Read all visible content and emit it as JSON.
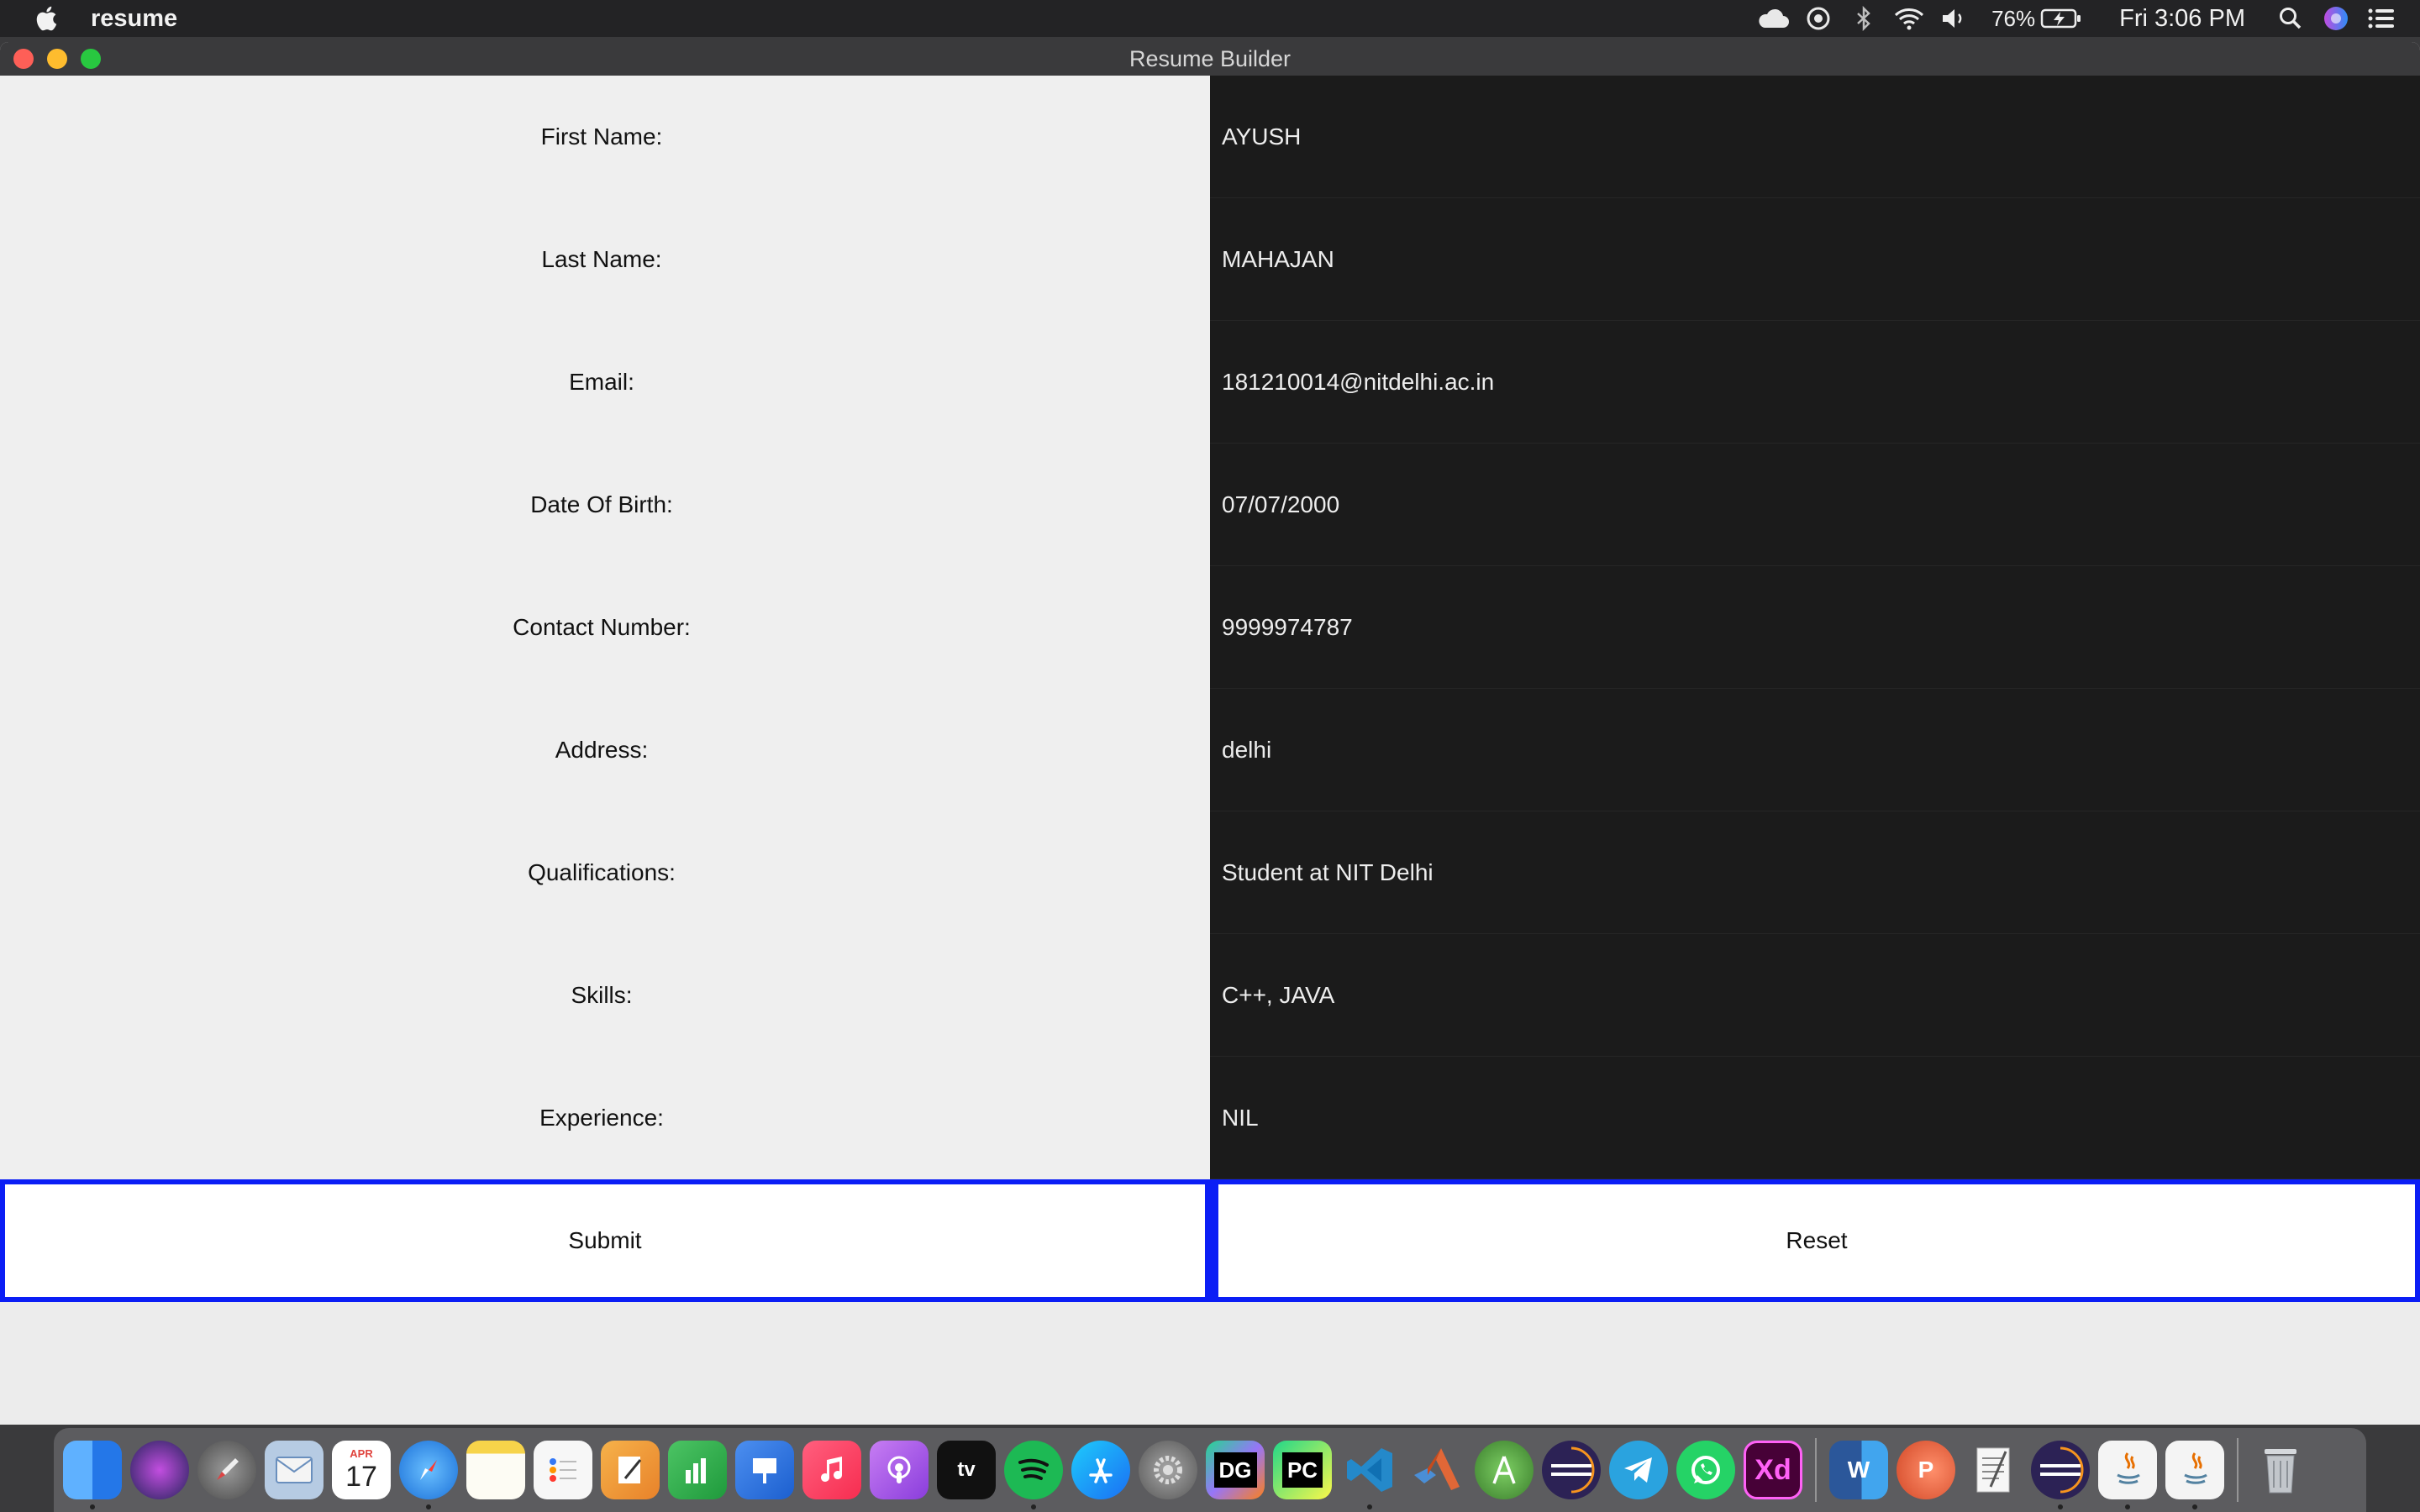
{
  "menubar": {
    "app_name": "resume",
    "battery_percent": "76%",
    "clock": "Fri 3:06 PM"
  },
  "window": {
    "title": "Resume Builder"
  },
  "form": {
    "fields": [
      {
        "label": "First Name:",
        "value": "AYUSH"
      },
      {
        "label": "Last Name:",
        "value": "MAHAJAN"
      },
      {
        "label": "Email:",
        "value": "181210014@nitdelhi.ac.in"
      },
      {
        "label": "Date Of Birth:",
        "value": "07/07/2000"
      },
      {
        "label": "Contact Number:",
        "value": "9999974787"
      },
      {
        "label": "Address:",
        "value": "delhi"
      },
      {
        "label": "Qualifications:",
        "value": "Student at NIT Delhi"
      },
      {
        "label": "Skills:",
        "value": "C++, JAVA"
      },
      {
        "label": "Experience:",
        "value": "NIL"
      }
    ],
    "submit_label": "Submit",
    "reset_label": "Reset"
  },
  "dock": {
    "calendar_month": "APR",
    "calendar_day": "17",
    "apps": [
      {
        "name": "finder",
        "color": "#3d8af7"
      },
      {
        "name": "siri",
        "color": "#3b2d7a"
      },
      {
        "name": "launchpad",
        "color": "#6b6b6b"
      },
      {
        "name": "mail",
        "color": "#9bb7d8"
      },
      {
        "name": "calendar",
        "color": "#ffffff"
      },
      {
        "name": "safari",
        "color": "#2a8ae6"
      },
      {
        "name": "notes",
        "color": "#f7d44a"
      },
      {
        "name": "reminders",
        "color": "#f2f2f2"
      },
      {
        "name": "pages",
        "color": "#f39a2b"
      },
      {
        "name": "numbers",
        "color": "#2fae4d"
      },
      {
        "name": "keynote",
        "color": "#2f6fd6"
      },
      {
        "name": "music",
        "color": "#fa3a5a"
      },
      {
        "name": "podcasts",
        "color": "#9b4ce8"
      },
      {
        "name": "apple-tv",
        "color": "#111111"
      },
      {
        "name": "spotify",
        "color": "#1db954"
      },
      {
        "name": "app-store",
        "color": "#1c8ef9"
      },
      {
        "name": "system-preferences",
        "color": "#8a8a8a"
      },
      {
        "name": "datagrip",
        "color": "#1a1a1a"
      },
      {
        "name": "pycharm",
        "color": "#1a1a1a"
      },
      {
        "name": "vscode",
        "color": "#1f7acc"
      },
      {
        "name": "matlab",
        "color": "#e3731c"
      },
      {
        "name": "android-studio",
        "color": "#3ddc84"
      },
      {
        "name": "eclipse",
        "color": "#2c2255"
      },
      {
        "name": "telegram",
        "color": "#2aa3df"
      },
      {
        "name": "whatsapp",
        "color": "#25d366"
      },
      {
        "name": "adobe-xd",
        "color": "#470137"
      },
      {
        "name": "word",
        "color": "#2b579a"
      },
      {
        "name": "powerpoint",
        "color": "#d24726"
      },
      {
        "name": "textedit",
        "color": "#f4f4f4"
      },
      {
        "name": "eclipse-2",
        "color": "#2c2255"
      },
      {
        "name": "java-1",
        "color": "#f4f4f4"
      },
      {
        "name": "java-2",
        "color": "#f4f4f4"
      },
      {
        "name": "trash",
        "color": "#b9bcc0"
      }
    ],
    "labels": {
      "appletv": "tv",
      "datagrip": "DG",
      "pycharm": "PC",
      "xd": "Xd",
      "word": "W",
      "powerpoint": "P"
    }
  }
}
